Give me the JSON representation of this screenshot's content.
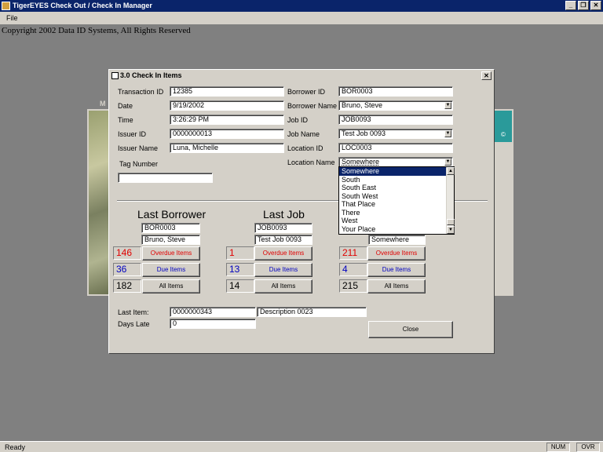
{
  "app": {
    "title": "TigerEYES Check Out / Check In Manager",
    "menu": [
      "File"
    ],
    "copyright": "Copyright 2002 Data ID Systems, All Rights Reserved",
    "status": "Ready",
    "status_cells": [
      "NUM",
      "OVR"
    ],
    "window_buttons": [
      "_",
      "❐",
      "✕"
    ]
  },
  "background_window": {
    "title": "M",
    "teal_label": "©"
  },
  "dialog": {
    "title": "3.0 Check In Items",
    "close_glyph": "✕",
    "fields": {
      "transaction_id": {
        "label": "Transaction ID",
        "value": "12385"
      },
      "date": {
        "label": "Date",
        "value": "9/19/2002"
      },
      "time": {
        "label": "Time",
        "value": "3:26:29 PM"
      },
      "issuer_id": {
        "label": "Issuer ID",
        "value": "0000000013"
      },
      "issuer_name": {
        "label": "Issuer Name",
        "value": "Luna, Michelle"
      },
      "tag_number": {
        "label": "Tag Number",
        "value": ""
      },
      "borrower_id": {
        "label": "Borrower ID",
        "value": "BOR0003"
      },
      "borrower_name": {
        "label": "Borrower Name",
        "value": "Bruno, Steve"
      },
      "job_id": {
        "label": "Job ID",
        "value": "JOB0093"
      },
      "job_name": {
        "label": "Job Name",
        "value": "Test Job 0093"
      },
      "location_id": {
        "label": "Location ID",
        "value": "LOC0003"
      },
      "location_name": {
        "label": "Location Name",
        "value": "Somewhere"
      }
    },
    "location_options": [
      "Somewhere",
      "South",
      "South East",
      "South West",
      "That Place",
      "There",
      "West",
      "Your Place"
    ],
    "last_borrower": {
      "heading": "Last Borrower",
      "id": "BOR0003",
      "name": "Bruno, Steve",
      "overdue_count": "146",
      "due_count": "36",
      "all_count": "182"
    },
    "last_job": {
      "heading": "Last Job",
      "id": "JOB0093",
      "name": "Test Job 0093",
      "overdue_count": "1",
      "due_count": "13",
      "all_count": "14"
    },
    "last_location": {
      "name": "Somewhere",
      "overdue_count": "211",
      "due_count": "4",
      "all_count": "215"
    },
    "buttons": {
      "overdue": "Overdue Items",
      "due": "Due Items",
      "all": "All Items",
      "close": "Close"
    },
    "last_item": {
      "label": "Last Item:",
      "value": "0000000343",
      "description": "Description 0023"
    },
    "days_late": {
      "label": "Days Late",
      "value": "0"
    }
  }
}
